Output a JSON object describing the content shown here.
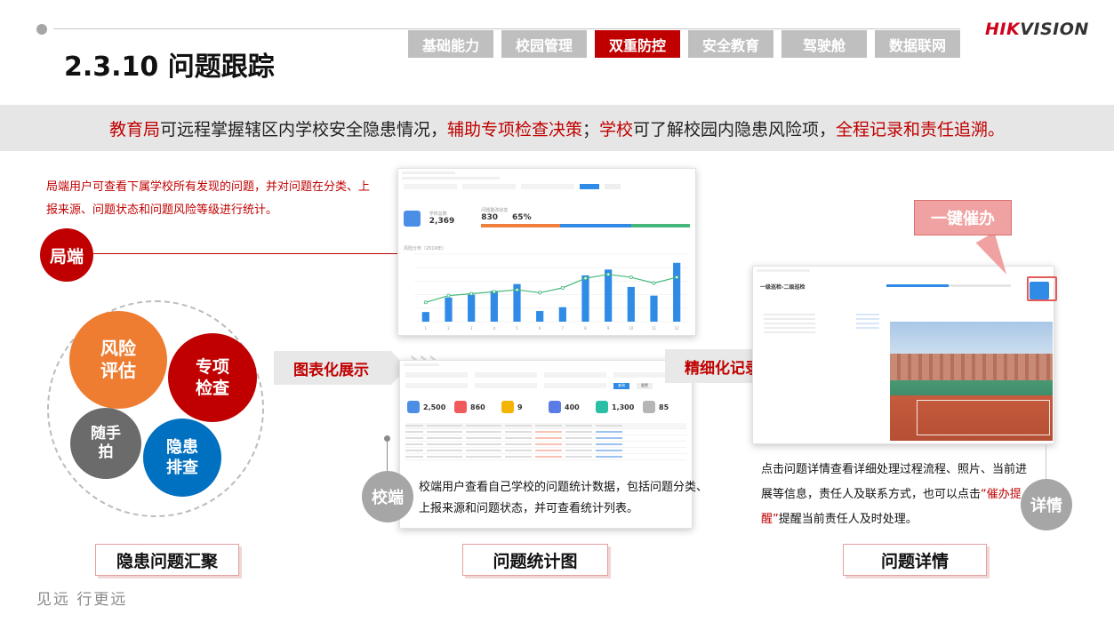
{
  "header": {
    "title": "2.3.10 问题跟踪",
    "tabs": [
      {
        "label": "基础能力",
        "active": false
      },
      {
        "label": "校园管理",
        "active": false
      },
      {
        "label": "双重防控",
        "active": true
      },
      {
        "label": "安全教育",
        "active": false
      },
      {
        "label": "驾驶舱",
        "active": false
      },
      {
        "label": "数据联网",
        "active": false
      }
    ],
    "logo_part1": "HIK",
    "logo_part2": "VISION"
  },
  "banner": {
    "p1": "教育局",
    "p2": "可远程掌握辖区内学校安全隐患情况，",
    "p3": "辅助专项检查决策",
    "p4": "；",
    "p5": "学校",
    "p6": "可了解校园内隐患风险项，",
    "p7": "全程记录和责任追溯。"
  },
  "left": {
    "description": "局端用户可查看下属学校所有发现的问题，并对问题在分类、上报来源、问题状态和问题风险等级进行统计。",
    "bureau_node": "局端",
    "circles": {
      "risk_l1": "风险",
      "risk_l2": "评估",
      "special_l1": "专项",
      "special_l2": "检查",
      "snap_l1": "随手",
      "snap_l2": "拍",
      "hidden_l1": "隐患",
      "hidden_l2": "排查"
    },
    "bottom_label": "隐患问题汇聚"
  },
  "middle": {
    "arrow_label": "图表化展示",
    "screenshot_top": {
      "total_caption": "学校总数",
      "total_value": "2,369",
      "status_caption": "问题整改状态",
      "status_value": "830",
      "rate_value": "65%",
      "chart_title": "风险分布（2019年）"
    },
    "screenshot_bottom": {
      "cards": [
        {
          "value": "2,500",
          "color": "#4a8ee6"
        },
        {
          "value": "860",
          "color": "#f05a5a"
        },
        {
          "value": "9",
          "color": "#f4b400"
        },
        {
          "value": "400",
          "color": "#5b7be6"
        },
        {
          "value": "1,300",
          "color": "#2bbfa4"
        },
        {
          "value": "85",
          "color": "#b5b5b5"
        }
      ],
      "search_btn": "查询",
      "reset_btn": "重置"
    },
    "school_node": "校端",
    "school_description": "校端用户查看自己学校的问题统计数据，包括问题分类、上报来源和问题状态，并可查看统计列表。",
    "bottom_label": "问题统计图"
  },
  "right": {
    "arrow_label": "精细化记录",
    "callout": "一键催办",
    "screenshot": {
      "title": "一级巡检-二级巡检"
    },
    "detail_p1": "点击问题详情查看详细处理过程流程、照片、当前进展等信息，责任人及联系方式，也可以点击",
    "detail_red": "“催办提醒”",
    "detail_p2": "提醒当前责任人及时处理。",
    "detail_node": "详情",
    "bottom_label": "问题详情"
  },
  "footer": "见远 行更远",
  "chart_data": {
    "type": "bar",
    "categories": [
      "1",
      "2",
      "3",
      "4",
      "5",
      "6",
      "7",
      "8",
      "9",
      "10",
      "11",
      "12"
    ],
    "series": [
      {
        "type": "bar",
        "values": [
          1,
          2.5,
          2.8,
          3.2,
          3.9,
          1.1,
          1.5,
          4.8,
          5.4,
          3.6,
          2.7,
          6.1
        ]
      },
      {
        "type": "line",
        "values": [
          2.0,
          2.7,
          2.9,
          3.1,
          3.3,
          3.0,
          3.5,
          4.5,
          4.9,
          4.6,
          4.0,
          4.6
        ]
      }
    ],
    "ylim": [
      0,
      7
    ],
    "grid": true,
    "legend_position": "top"
  }
}
